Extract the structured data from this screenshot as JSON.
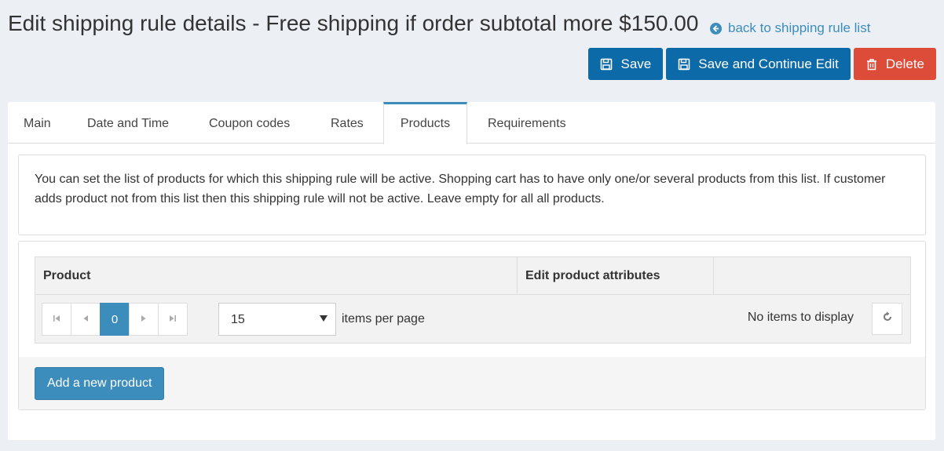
{
  "header": {
    "title": "Edit shipping rule details - Free shipping if order subtotal more $150.00",
    "back_link": "back to shipping rule list"
  },
  "toolbar": {
    "save_label": "Save",
    "save_continue_label": "Save and Continue Edit",
    "delete_label": "Delete",
    "save_icon": "floppy-disk-icon",
    "delete_icon": "trash-icon"
  },
  "tabs": [
    {
      "label": "Main"
    },
    {
      "label": "Date and Time"
    },
    {
      "label": "Coupon codes"
    },
    {
      "label": "Rates"
    },
    {
      "label": "Products",
      "active": true
    },
    {
      "label": "Requirements"
    }
  ],
  "products": {
    "info_text": "You can set the list of products for which this shipping rule will be active. Shopping cart has to have only one/or several products from this list. If customer adds product not from this list then this shipping rule will not be active. Leave empty for all all products.",
    "grid": {
      "columns": [
        "Product",
        "Edit product attributes",
        ""
      ],
      "rows": [],
      "pager": {
        "current_page": "0",
        "page_size": "15",
        "items_per_page_label": "items per page",
        "empty_label": "No items to display"
      }
    },
    "add_button_label": "Add a new product"
  },
  "colors": {
    "primary": "#0d6aa8",
    "link": "#3c8dbc",
    "danger": "#dd4b39",
    "background": "#ecf0f5"
  }
}
